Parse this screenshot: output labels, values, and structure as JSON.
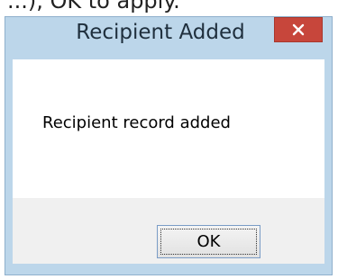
{
  "background": {
    "partial_text": "...), OK to apply."
  },
  "dialog": {
    "title": "Recipient Added",
    "close_glyph": "×",
    "message": "Recipient record added",
    "ok_label": "OK"
  },
  "colors": {
    "frame": "#bcd6ea",
    "close_button": "#c7463b",
    "footer": "#f0f0f0"
  }
}
